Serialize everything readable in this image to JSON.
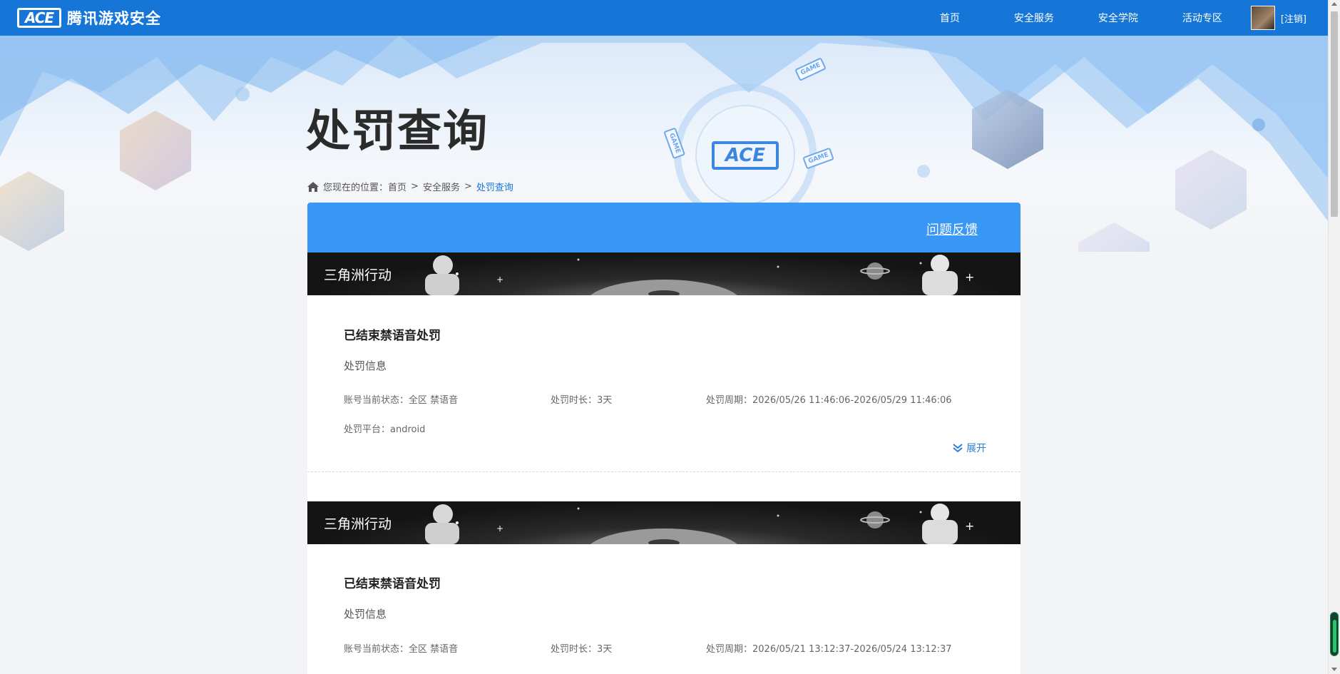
{
  "header": {
    "logo_mark": "ACE",
    "logo_text": "腾讯游戏安全",
    "nav": [
      "首页",
      "安全服务",
      "安全学院",
      "活动专区"
    ],
    "logout": "[注销]"
  },
  "hero": {
    "title": "处罚查询",
    "center_logo": "ACE",
    "game_tags": [
      "GAME",
      "GAME",
      "GAME"
    ]
  },
  "breadcrumb": {
    "prefix": "您现在的位置：",
    "items": [
      "首页",
      "安全服务",
      "处罚查询"
    ],
    "separator": ">"
  },
  "card": {
    "feedback_label": "问题反馈"
  },
  "records": [
    {
      "game": "三角洲行动",
      "title": "已结束禁语音处罚",
      "subtitle": "处罚信息",
      "status": "账号当前状态：全区 禁语音",
      "duration": "处罚时长：3天",
      "period": "处罚周期：2026/05/26 11:46:06-2026/05/29 11:46:06",
      "platform": "处罚平台：android",
      "expand_label": "展开"
    },
    {
      "game": "三角洲行动",
      "title": "已结束禁语音处罚",
      "subtitle": "处罚信息",
      "status": "账号当前状态：全区 禁语音",
      "duration": "处罚时长：3天",
      "period": "处罚周期：2026/05/21 13:12:37-2026/05/24 13:12:37"
    }
  ],
  "colors": {
    "topbar": "#1676d8",
    "card_head": "#3997f5",
    "link": "#2a7ddb"
  }
}
